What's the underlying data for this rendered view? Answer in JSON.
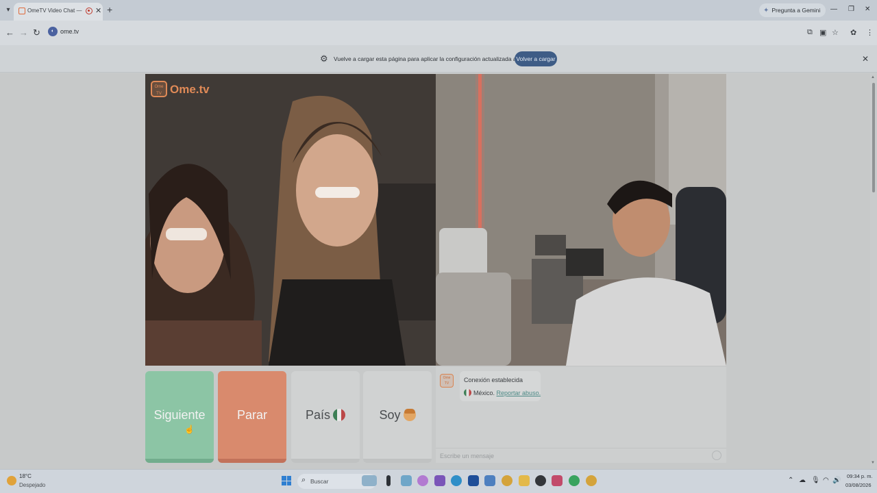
{
  "browser": {
    "tab_title": "OmeTV Video Chat — Ome",
    "tab_close": "✕",
    "new_tab": "+",
    "gemini_label": "Pregunta a Gemini",
    "url": "ome.tv"
  },
  "infobar": {
    "message": "Vuelve a cargar esta página para aplicar la configuración actualizada a este sitio",
    "reload_label": "Volver a cargar"
  },
  "site": {
    "logo_text": "Ome.tv",
    "logo_badge": "Ome TV"
  },
  "chat": {
    "status": "Conexión establecida",
    "country": "México.",
    "report_link": "Reportar abuso.",
    "input_placeholder": "Escribe un mensaje",
    "avatar_badge": "Ome TV"
  },
  "buttons": {
    "next": "Siguiente",
    "stop": "Parar",
    "country": "País",
    "gender": "Soy"
  },
  "taskbar": {
    "temperature": "18°C",
    "weather": "Despejado",
    "search_placeholder": "Buscar",
    "time": "09:34 p. m.",
    "date": "03/08/2026"
  },
  "colors": {
    "next_button": "#8cc5a5",
    "stop_button": "#d98a6d",
    "reload_button": "#3e5c86",
    "brand": "#e08a57",
    "report_link": "#4d8a86"
  },
  "icons": [
    "tab-list-icon",
    "recording-icon",
    "back-icon",
    "forward-icon",
    "reload-icon",
    "translate-icon",
    "cast-icon",
    "bookmark-star-icon",
    "extension-icon",
    "menu-icon",
    "gear-icon",
    "close-icon",
    "emoji-icon",
    "windows-start-icon",
    "search-icon"
  ]
}
